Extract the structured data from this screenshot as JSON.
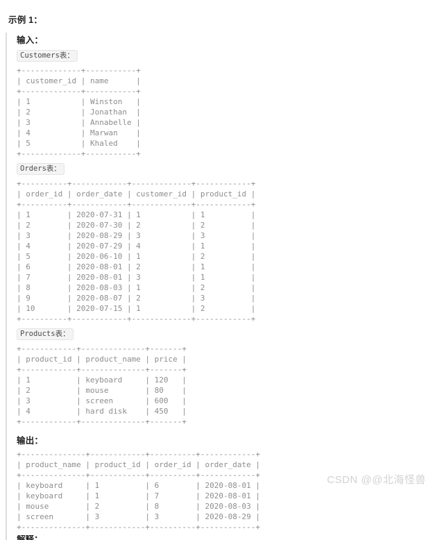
{
  "heading": "示例 1：",
  "input": {
    "label": "输入：",
    "tables": [
      {
        "caption": "Customers表：",
        "ascii": "+-------------+-----------+\n| customer_id | name      |\n+-------------+-----------+\n| 1           | Winston   |\n| 2           | Jonathan  |\n| 3           | Annabelle |\n| 4           | Marwan    |\n| 5           | Khaled    |\n+-------------+-----------+",
        "columns": [
          "customer_id",
          "name"
        ],
        "rows": [
          [
            "1",
            "Winston"
          ],
          [
            "2",
            "Jonathan"
          ],
          [
            "3",
            "Annabelle"
          ],
          [
            "4",
            "Marwan"
          ],
          [
            "5",
            "Khaled"
          ]
        ]
      },
      {
        "caption": "Orders表：",
        "ascii": "+----------+------------+-------------+------------+\n| order_id | order_date | customer_id | product_id |\n+----------+------------+-------------+------------+\n| 1        | 2020-07-31 | 1           | 1          |\n| 2        | 2020-07-30 | 2           | 2          |\n| 3        | 2020-08-29 | 3           | 3          |\n| 4        | 2020-07-29 | 4           | 1          |\n| 5        | 2020-06-10 | 1           | 2          |\n| 6        | 2020-08-01 | 2           | 1          |\n| 7        | 2020-08-01 | 3           | 1          |\n| 8        | 2020-08-03 | 1           | 2          |\n| 9        | 2020-08-07 | 2           | 3          |\n| 10       | 2020-07-15 | 1           | 2          |\n+----------+------------+-------------+------------+",
        "columns": [
          "order_id",
          "order_date",
          "customer_id",
          "product_id"
        ],
        "rows": [
          [
            "1",
            "2020-07-31",
            "1",
            "1"
          ],
          [
            "2",
            "2020-07-30",
            "2",
            "2"
          ],
          [
            "3",
            "2020-08-29",
            "3",
            "3"
          ],
          [
            "4",
            "2020-07-29",
            "4",
            "1"
          ],
          [
            "5",
            "2020-06-10",
            "1",
            "2"
          ],
          [
            "6",
            "2020-08-01",
            "2",
            "1"
          ],
          [
            "7",
            "2020-08-01",
            "3",
            "1"
          ],
          [
            "8",
            "2020-08-03",
            "1",
            "2"
          ],
          [
            "9",
            "2020-08-07",
            "2",
            "3"
          ],
          [
            "10",
            "2020-07-15",
            "1",
            "2"
          ]
        ]
      },
      {
        "caption": "Products表：",
        "ascii": "+------------+--------------+-------+\n| product_id | product_name | price |\n+------------+--------------+-------+\n| 1          | keyboard     | 120   |\n| 2          | mouse        | 80    |\n| 3          | screen       | 600   |\n| 4          | hard disk    | 450   |\n+------------+--------------+-------+",
        "columns": [
          "product_id",
          "product_name",
          "price"
        ],
        "rows": [
          [
            "1",
            "keyboard",
            "120"
          ],
          [
            "2",
            "mouse",
            "80"
          ],
          [
            "3",
            "screen",
            "600"
          ],
          [
            "4",
            "hard disk",
            "450"
          ]
        ]
      }
    ]
  },
  "output": {
    "label": "输出：",
    "table": {
      "ascii": "+--------------+------------+----------+------------+\n| product_name | product_id | order_id | order_date |\n+--------------+------------+----------+------------+\n| keyboard     | 1          | 6        | 2020-08-01 |\n| keyboard     | 1          | 7        | 2020-08-01 |\n| mouse        | 2          | 8        | 2020-08-03 |\n| screen       | 3          | 3        | 2020-08-29 |\n+--------------+------------+----------+------------+",
      "columns": [
        "product_name",
        "product_id",
        "order_id",
        "order_date"
      ],
      "rows": [
        [
          "keyboard",
          "1",
          "6",
          "2020-08-01"
        ],
        [
          "keyboard",
          "1",
          "7",
          "2020-08-01"
        ],
        [
          "mouse",
          "2",
          "8",
          "2020-08-03"
        ],
        [
          "screen",
          "3",
          "3",
          "2020-08-29"
        ]
      ]
    }
  },
  "bottom_partial_label": "解释：",
  "watermark": "CSDN @@北海怪兽",
  "colors": {
    "background": "#ffffff",
    "heading_text": "#1f1f1f",
    "code_text": "#8d8d8d",
    "quote_border": "#dcdcdc",
    "inline_code_bg": "#f4f4f4",
    "watermark": "#d2d2d2"
  }
}
